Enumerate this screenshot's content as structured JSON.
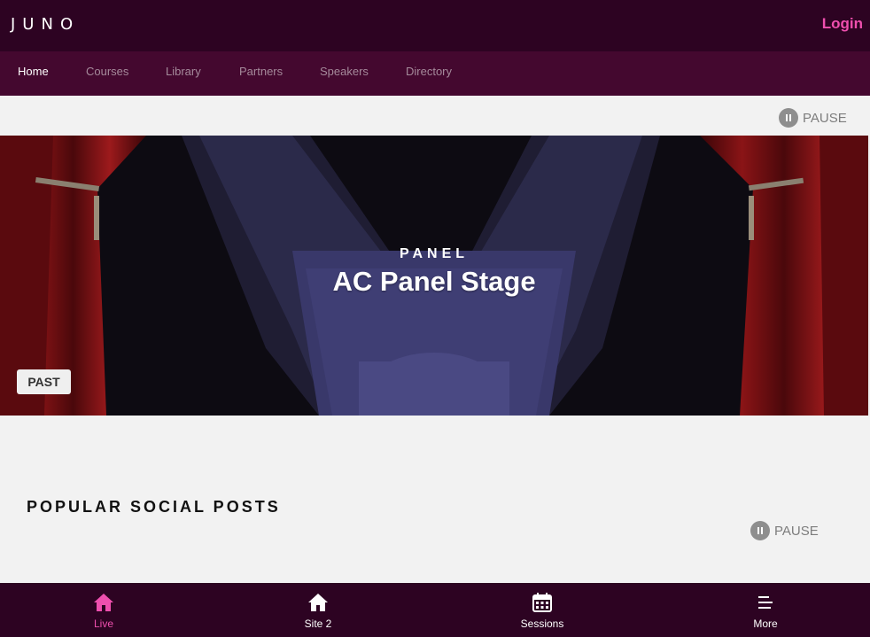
{
  "header": {
    "logo_text": "JUNO",
    "login_label": "Login"
  },
  "nav": {
    "items": [
      {
        "label": "Home",
        "active": true
      },
      {
        "label": "Courses"
      },
      {
        "label": "Library"
      },
      {
        "label": "Partners"
      },
      {
        "label": "Speakers"
      },
      {
        "label": "Directory"
      }
    ]
  },
  "hero": {
    "pause_label": "PAUSE",
    "eyebrow": "PANEL",
    "title": "AC Panel Stage",
    "badge": "PAST"
  },
  "social": {
    "title": "POPULAR SOCIAL POSTS",
    "pause_label": "PAUSE"
  },
  "bottom_nav": {
    "tabs": [
      {
        "label": "Live",
        "icon": "home-icon",
        "active": true
      },
      {
        "label": "Site 2",
        "icon": "home-icon"
      },
      {
        "label": "Sessions",
        "icon": "calendar-icon"
      },
      {
        "label": "More",
        "icon": "menu-lines-icon"
      }
    ]
  },
  "colors": {
    "brand_dark": "#2d0322",
    "nav_bg": "#44082f",
    "accent": "#ee4fae"
  }
}
